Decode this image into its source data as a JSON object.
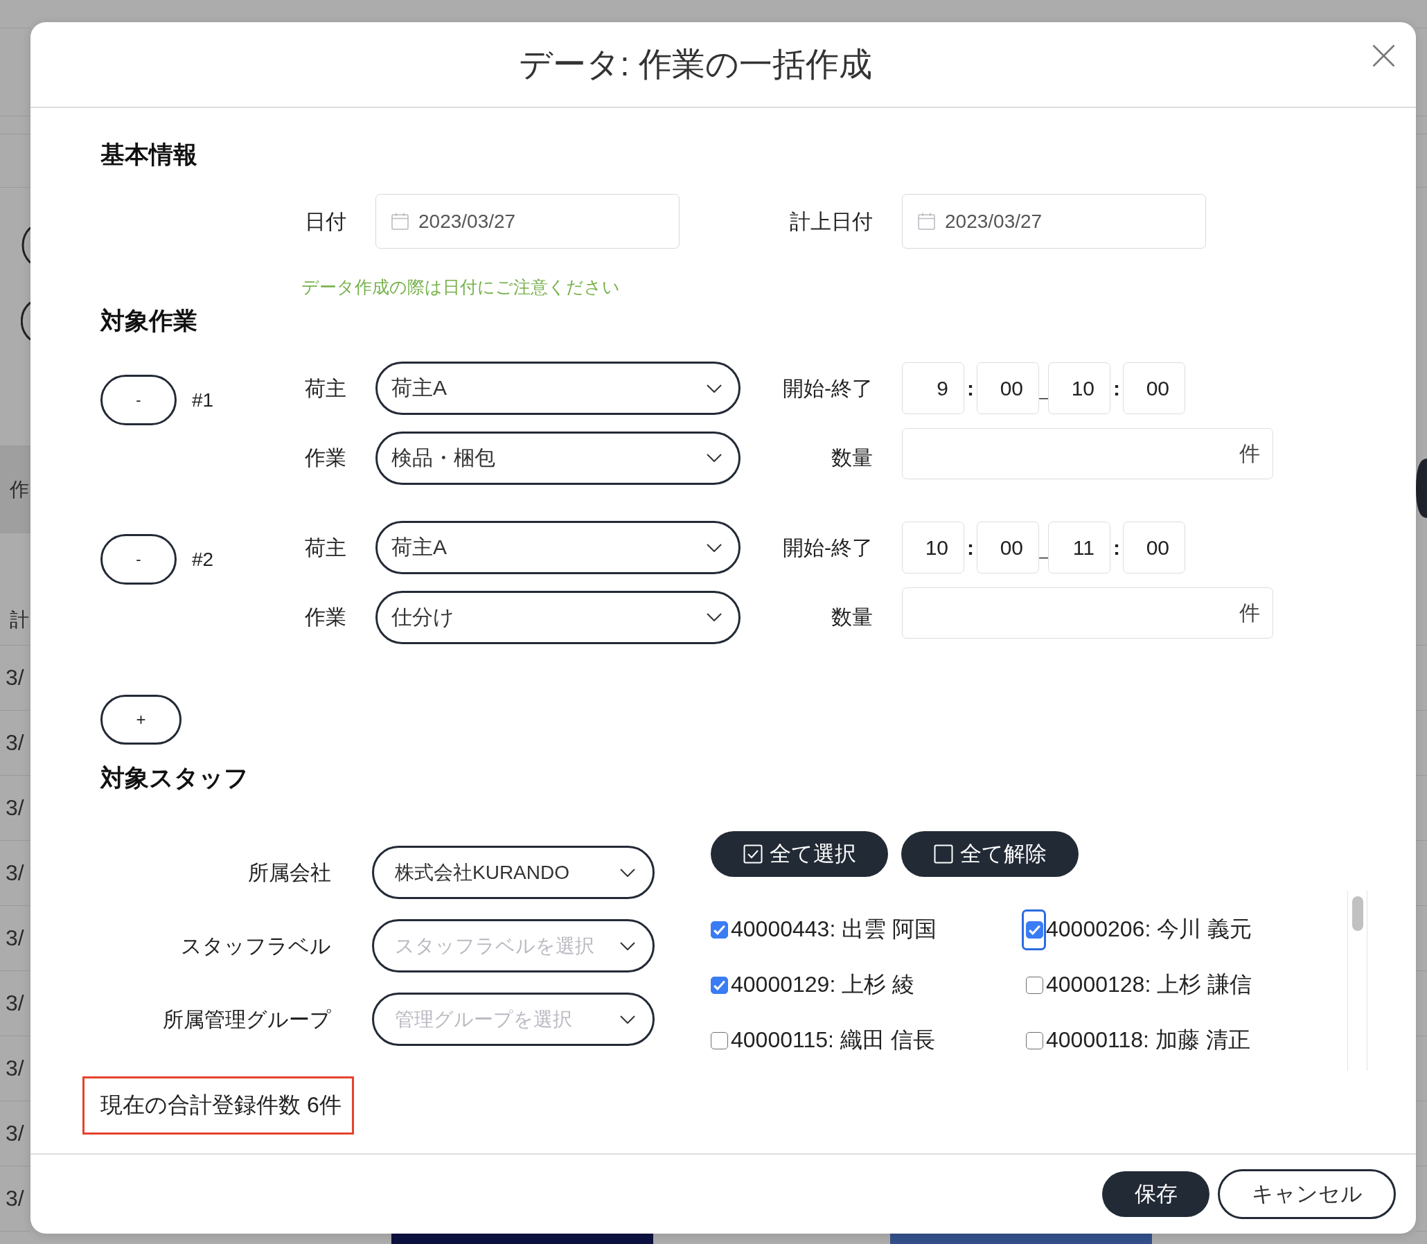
{
  "background": {
    "side_labels": [
      "作",
      "計"
    ],
    "row_dates": [
      "3/",
      "3/",
      "3/",
      "3/",
      "3/",
      "3/",
      "3/",
      "3/",
      "3/"
    ]
  },
  "dialog": {
    "title": "データ: 作業の一括作成"
  },
  "basic_info": {
    "heading": "基本情報",
    "date_fields": [
      {
        "label": "日付",
        "value": "2023/03/27"
      },
      {
        "label": "計上日付",
        "value": "2023/03/27"
      }
    ],
    "hint": "データ作成の際は日付にご注意ください"
  },
  "tasks": {
    "heading": "対象作業",
    "items": [
      {
        "remove_button": "-",
        "number": "#1",
        "shipper": {
          "label": "荷主",
          "value": "荷主A"
        },
        "task": {
          "label": "作業",
          "value": "検品・梱包"
        },
        "time": {
          "label": "開始-終了",
          "parts": [
            {
              "kind": "field",
              "text": "9"
            },
            {
              "kind": "colon",
              "text": ":"
            },
            {
              "kind": "field",
              "text": "00"
            },
            {
              "kind": "dash",
              "text": "_"
            },
            {
              "kind": "field",
              "text": "10"
            },
            {
              "kind": "colon",
              "text": ":"
            },
            {
              "kind": "field",
              "text": "00"
            }
          ]
        },
        "quantity": {
          "label": "数量",
          "unit": "件"
        }
      },
      {
        "remove_button": "-",
        "number": "#2",
        "shipper": {
          "label": "荷主",
          "value": "荷主A"
        },
        "task": {
          "label": "作業",
          "value": "仕分け"
        },
        "time": {
          "label": "開始-終了",
          "parts": [
            {
              "kind": "field",
              "text": "10"
            },
            {
              "kind": "colon",
              "text": ":"
            },
            {
              "kind": "field",
              "text": "00"
            },
            {
              "kind": "dash",
              "text": "_"
            },
            {
              "kind": "field",
              "text": "11"
            },
            {
              "kind": "colon",
              "text": ":"
            },
            {
              "kind": "field",
              "text": "00"
            }
          ]
        },
        "quantity": {
          "label": "数量",
          "unit": "件"
        }
      }
    ],
    "add_button": "+"
  },
  "staff": {
    "heading": "対象スタッフ",
    "filters": [
      {
        "label": "所属会社",
        "value": "株式会社KURANDO"
      },
      {
        "label": "スタッフラベル",
        "placeholder": "スタッフラベルを選択"
      },
      {
        "label": "所属管理グループ",
        "placeholder": "管理グループを選択"
      }
    ],
    "bulk_buttons": [
      {
        "label": "全て選択",
        "kind": "select_all"
      },
      {
        "label": "全て解除",
        "kind": "clear_all"
      }
    ],
    "members": [
      {
        "label": "40000443: 出雲 阿国",
        "checked": true,
        "focused": false
      },
      {
        "label": "40000206: 今川 義元",
        "checked": true,
        "focused": true
      },
      {
        "label": "40000129: 上杉 綾",
        "checked": true,
        "focused": false
      },
      {
        "label": "40000128: 上杉 謙信",
        "checked": false,
        "focused": false
      },
      {
        "label": "40000115: 織田 信長",
        "checked": false,
        "focused": false
      },
      {
        "label": "40000118: 加藤 清正",
        "checked": false,
        "focused": false
      }
    ]
  },
  "summary": "現在の合計登録件数 6件",
  "footer": {
    "buttons": [
      {
        "label": "保存",
        "kind": "primary"
      },
      {
        "label": "キャンセル",
        "kind": "secondary"
      }
    ]
  }
}
